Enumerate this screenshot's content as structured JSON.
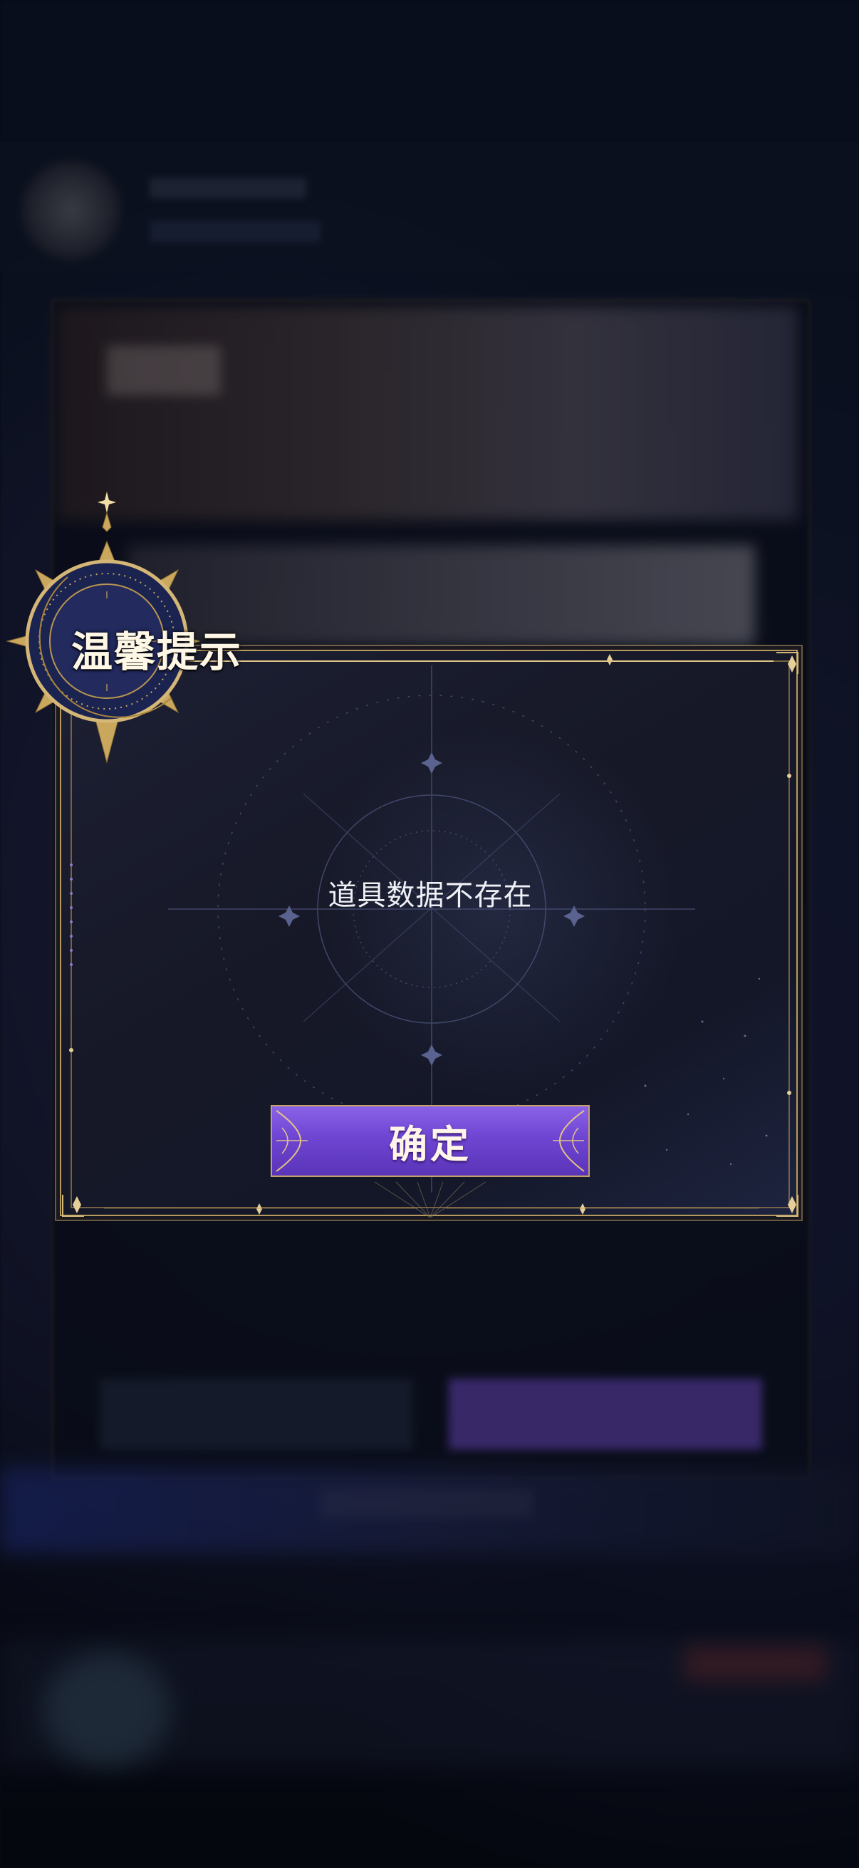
{
  "dialog": {
    "title": "温馨提示",
    "message": "道具数据不存在",
    "confirm_label": "确定"
  },
  "colors": {
    "gold_border": "#b89a5e",
    "button_purple": "#6e45d2",
    "panel_bg": "#161827",
    "text_light": "#eef0f6"
  }
}
